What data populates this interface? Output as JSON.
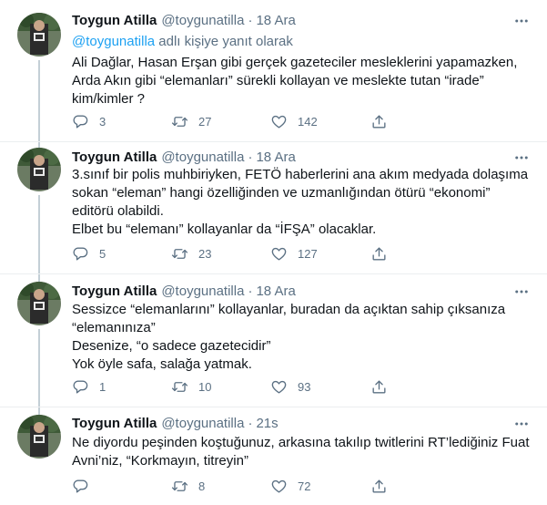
{
  "tweets": [
    {
      "name": "Toygun Atilla",
      "handle": "@toygunatilla",
      "sep": "·",
      "time": "18 Ara",
      "reply_mention": "@toygunatilla",
      "reply_suffix": " adlı kişiye yanıt olarak",
      "lines": [
        "Ali Dağlar, Hasan Erşan gibi gerçek gazeteciler mesleklerini yapamazken,",
        "Arda Akın gibi “elemanları” sürekli kollayan ve meslekte tutan “irade”",
        "kim/kimler ?"
      ],
      "replies": "3",
      "retweets": "27",
      "likes": "142"
    },
    {
      "name": "Toygun Atilla",
      "handle": "@toygunatilla",
      "sep": "·",
      "time": "18 Ara",
      "lines": [
        "3.sınıf bir polis muhbiriyken, FETÖ haberlerini ana akım medyada dolaşıma",
        "sokan “eleman” hangi özelliğinden ve uzmanlığından ötürü “ekonomi”",
        "editörü olabildi.",
        "Elbet bu “elemanı” kollayanlar da “İFŞA” olacaklar."
      ],
      "replies": "5",
      "retweets": "23",
      "likes": "127"
    },
    {
      "name": "Toygun Atilla",
      "handle": "@toygunatilla",
      "sep": "·",
      "time": "18 Ara",
      "lines": [
        "Sessizce “elemanlarını” kollayanlar, buradan da açıktan sahip çıksanıza",
        "“elemanınıza”",
        "Desenize, “o sadece gazetecidir”",
        "Yok öyle safa, salağa yatmak."
      ],
      "replies": "1",
      "retweets": "10",
      "likes": "93"
    },
    {
      "name": "Toygun Atilla",
      "handle": "@toygunatilla",
      "sep": "·",
      "time": "21s",
      "lines": [
        "Ne diyordu peşinden koştuğunuz, arkasına takılıp twitlerini RT’lediğiniz Fuat",
        "Avni’niz, “Korkmayın, titreyin”"
      ],
      "replies": "",
      "retweets": "8",
      "likes": "72"
    }
  ],
  "icons": {
    "more": "more-icon",
    "reply": "reply-icon",
    "retweet": "retweet-icon",
    "like": "heart-icon",
    "share": "share-icon"
  },
  "colors": {
    "accent": "#1da1f2",
    "secondary_text": "#5b7083",
    "divider": "#ebeef0",
    "thread_line": "#c4cfd6"
  }
}
